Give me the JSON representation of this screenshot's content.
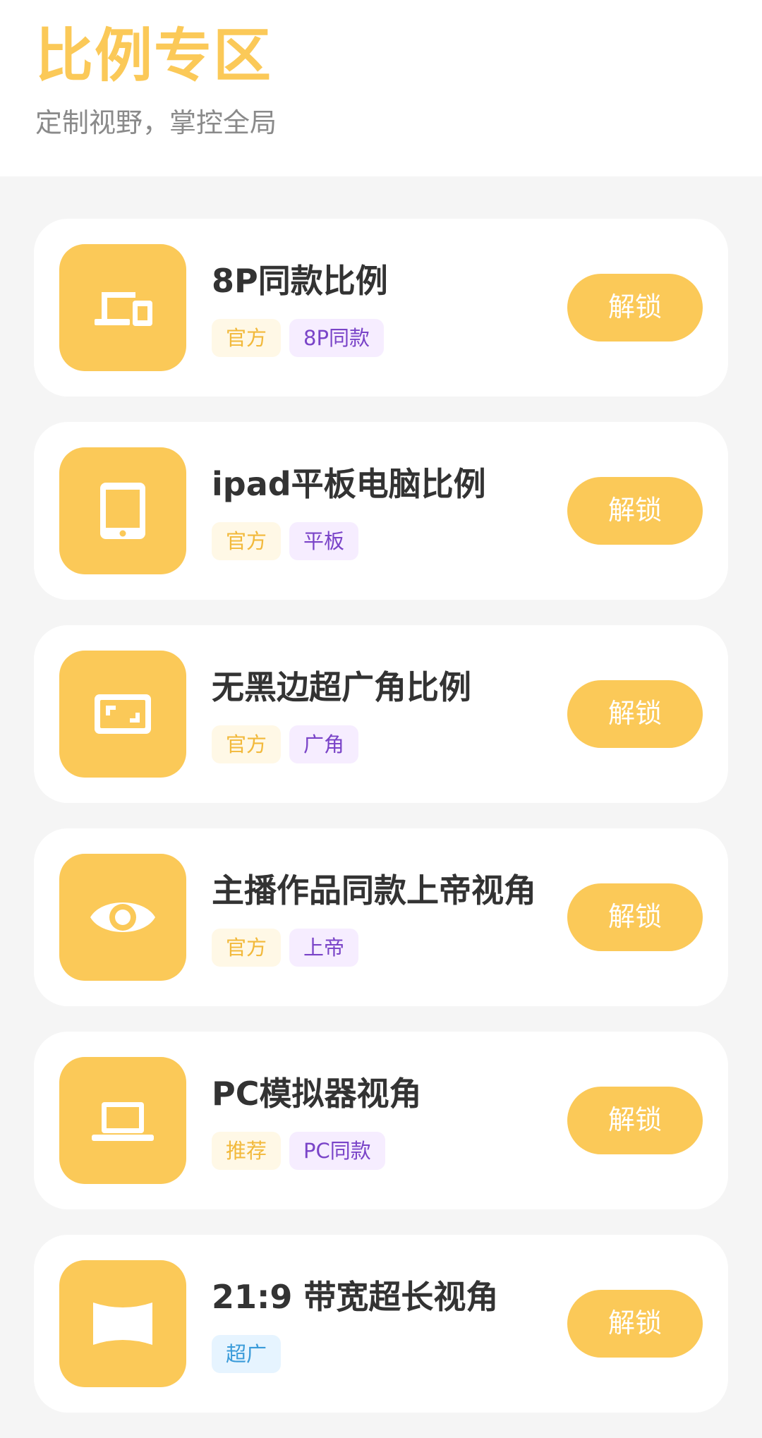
{
  "header": {
    "title": "比例专区",
    "subtitle": "定制视野，掌控全局"
  },
  "colors": {
    "accent": "#fbc958",
    "tag_yellow_text": "#f2b93b",
    "tag_purple_text": "#7a44c8",
    "tag_blue_text": "#3a9bd9"
  },
  "cards": [
    {
      "title": "8P同款比例",
      "icon": "devices-icon",
      "button": "解锁",
      "tags": [
        {
          "label": "官方",
          "style": "yellow"
        },
        {
          "label": "8P同款",
          "style": "purple"
        }
      ]
    },
    {
      "title": "ipad平板电脑比例",
      "icon": "tablet-icon",
      "button": "解锁",
      "tags": [
        {
          "label": "官方",
          "style": "yellow"
        },
        {
          "label": "平板",
          "style": "purple"
        }
      ]
    },
    {
      "title": "无黑边超广角比例",
      "icon": "aspect-ratio-icon",
      "button": "解锁",
      "tags": [
        {
          "label": "官方",
          "style": "yellow"
        },
        {
          "label": "广角",
          "style": "purple"
        }
      ]
    },
    {
      "title": "主播作品同款上帝视角",
      "icon": "eye-icon",
      "button": "解锁",
      "tags": [
        {
          "label": "官方",
          "style": "yellow"
        },
        {
          "label": "上帝",
          "style": "purple"
        }
      ]
    },
    {
      "title": "PC模拟器视角",
      "icon": "laptop-icon",
      "button": "解锁",
      "tags": [
        {
          "label": "推荐",
          "style": "yellow"
        },
        {
          "label": "PC同款",
          "style": "purple"
        }
      ]
    },
    {
      "title": "21:9 带宽超长视角",
      "icon": "panorama-icon",
      "button": "解锁",
      "tags": [
        {
          "label": "超广",
          "style": "blue"
        }
      ]
    }
  ]
}
